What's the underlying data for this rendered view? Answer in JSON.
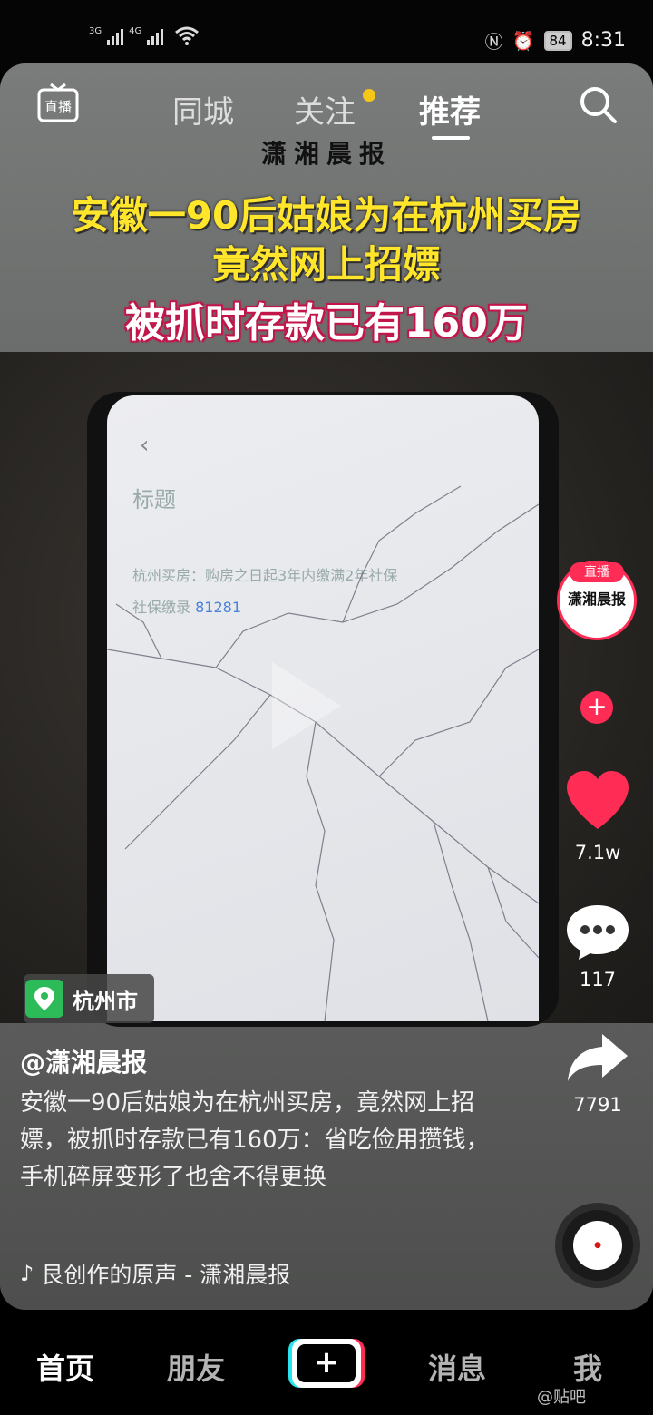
{
  "status_bar": {
    "signal1_label": "3G",
    "signal2_label": "4G",
    "battery": "84",
    "time": "8:31"
  },
  "top_nav": {
    "live_label": "直播",
    "tabs": [
      "同城",
      "关注",
      "推荐"
    ],
    "active_tab": "推荐"
  },
  "video": {
    "brand": "潇湘晨报",
    "headline_line1": "安徽一90后姑娘为在杭州买房",
    "headline_line2": "竟然网上招嫖",
    "headline_line3": "被抓时存款已有160万",
    "screen_title": "标题",
    "screen_line1": "杭州买房：购房之日起3年内缴满2年社保",
    "screen_line2_prefix": "社保缴录 ",
    "screen_line2_value": "81281",
    "location": "杭州市"
  },
  "side_rail": {
    "avatar_live_badge": "直播",
    "avatar_text": "潇湘晨报",
    "likes": "7.1w",
    "comments": "117",
    "shares": "7791"
  },
  "caption": {
    "author": "@潇湘晨报",
    "text": "安徽一90后姑娘为在杭州买房，竟然网上招嫖，被抓时存款已有160万：省吃俭用攒钱，手机碎屏变形了也舍不得更换",
    "music": "艮创作的原声 - 潇湘晨报"
  },
  "bottom_bar": {
    "items": [
      "首页",
      "朋友",
      "消息",
      "我"
    ],
    "plus": "+"
  },
  "watermark": "@贴吧",
  "colors": {
    "accent_red": "#ff2c55",
    "headline_yellow": "#ffe62b",
    "location_green": "#2dbb5a"
  }
}
